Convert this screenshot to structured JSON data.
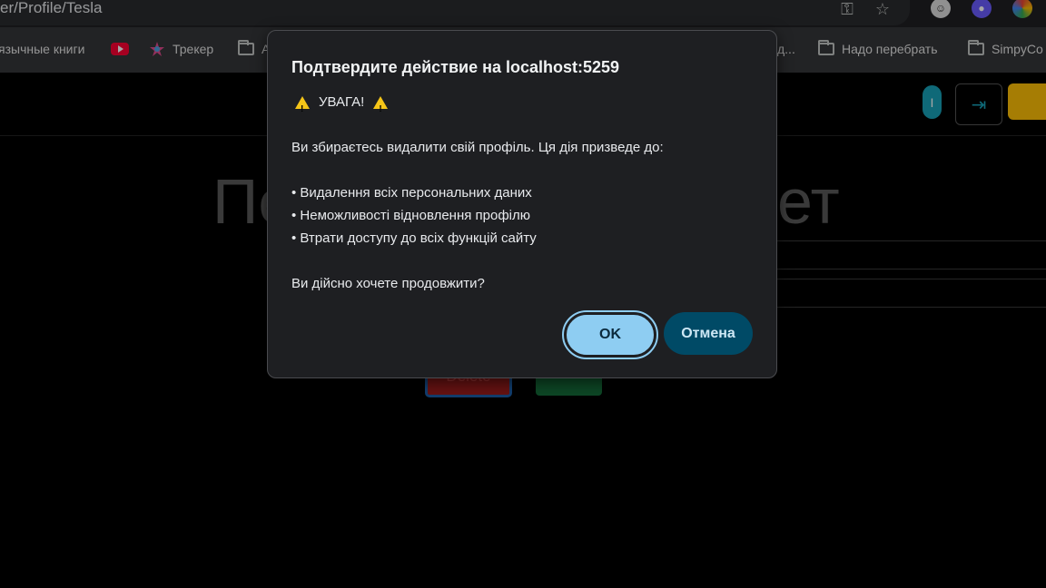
{
  "browser": {
    "url": "er/Profile/Tesla",
    "bookmarks": [
      {
        "label": "язычные книги"
      },
      {
        "label": ""
      },
      {
        "label": "Трекер"
      },
      {
        "label": "А"
      },
      {
        "label": "д..."
      },
      {
        "label": "Надо перебрать"
      },
      {
        "label": "SimpyCo"
      }
    ]
  },
  "page": {
    "heading_left": "Пе",
    "heading_right": "ет",
    "delete_label": "Delete",
    "save_label": "Save",
    "avatar_letter": "I"
  },
  "dialog": {
    "title": "Подтвердите действие на localhost:5259",
    "warning": "УВАГА!",
    "intro": "Ви збираєтесь видалити свій профіль. Ця дія призведе до:",
    "items": [
      "• Видалення всіх персональних даних",
      "• Неможливості відновлення профілю",
      "• Втрати доступу до всіх функцій сайту"
    ],
    "question": "Ви дійсно хочете продовжити?",
    "ok_label": "OK",
    "cancel_label": "Отмена"
  }
}
